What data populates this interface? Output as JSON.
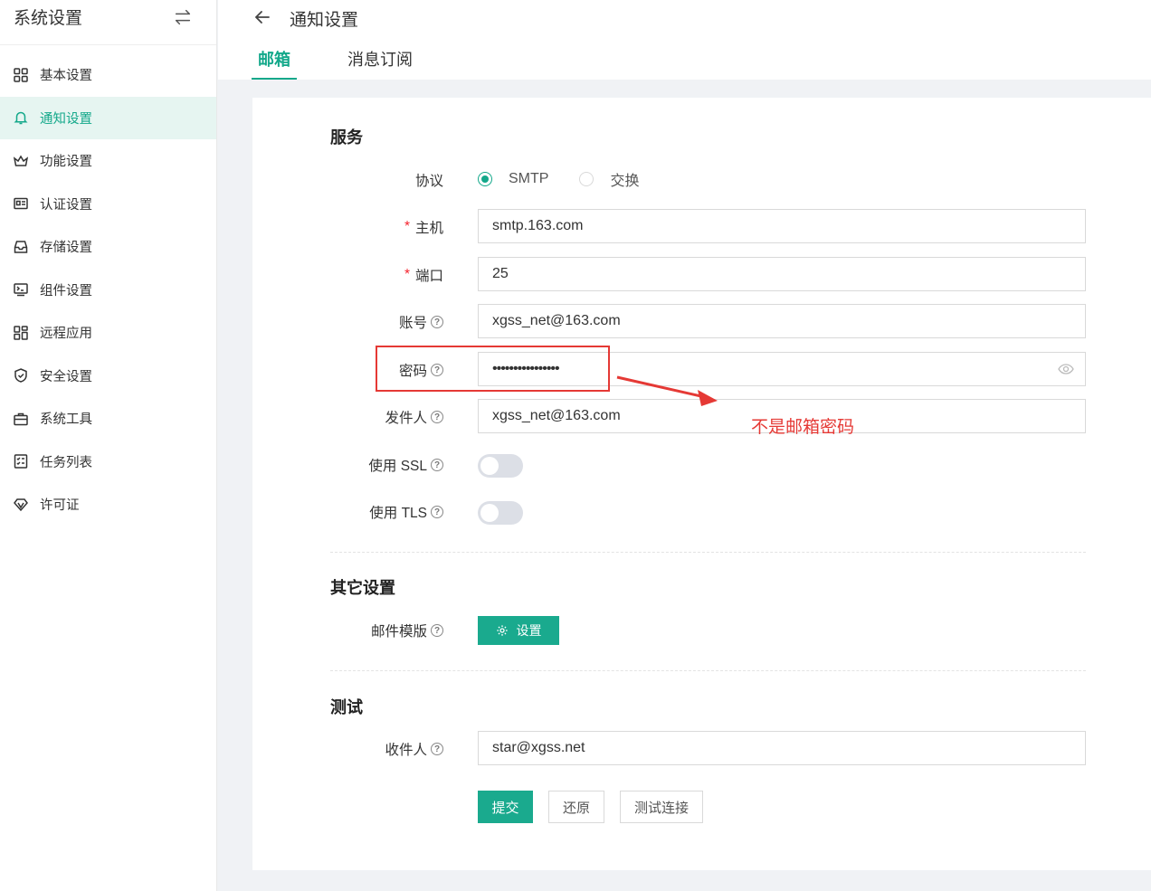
{
  "sidebar": {
    "title": "系统设置",
    "items": [
      {
        "label": "基本设置",
        "icon": "grid-icon"
      },
      {
        "label": "通知设置",
        "icon": "bell-icon",
        "active": true
      },
      {
        "label": "功能设置",
        "icon": "crown-icon"
      },
      {
        "label": "认证设置",
        "icon": "id-card-icon"
      },
      {
        "label": "存储设置",
        "icon": "inbox-icon"
      },
      {
        "label": "组件设置",
        "icon": "terminal-icon"
      },
      {
        "label": "远程应用",
        "icon": "apps-icon"
      },
      {
        "label": "安全设置",
        "icon": "shield-icon"
      },
      {
        "label": "系统工具",
        "icon": "toolbox-icon"
      },
      {
        "label": "任务列表",
        "icon": "task-list-icon"
      },
      {
        "label": "许可证",
        "icon": "diamond-icon"
      }
    ]
  },
  "header": {
    "title": "通知设置",
    "tabs": [
      {
        "label": "邮箱",
        "active": true
      },
      {
        "label": "消息订阅"
      }
    ]
  },
  "form": {
    "service_title": "服务",
    "protocol_label": "协议",
    "protocol_options": [
      "SMTP",
      "交换"
    ],
    "protocol_selected": "SMTP",
    "host_label": "主机",
    "host_value": "smtp.163.com",
    "port_label": "端口",
    "port_value": "25",
    "account_label": "账号",
    "account_value": "xgss_net@163.com",
    "password_label": "密码",
    "password_value": "••••••••••••••••",
    "sender_label": "发件人",
    "sender_value": "xgss_net@163.com",
    "ssl_label": "使用 SSL",
    "ssl_enabled": false,
    "tls_label": "使用 TLS",
    "tls_enabled": false,
    "other_title": "其它设置",
    "template_label": "邮件模版",
    "template_button": "设置",
    "test_title": "测试",
    "recipient_label": "收件人",
    "recipient_value": "star@xgss.net",
    "submit_button": "提交",
    "reset_button": "还原",
    "test_button": "测试连接",
    "help_mark": "?"
  },
  "annotation": {
    "text": "不是邮箱密码"
  },
  "colors": {
    "accent": "#13a88a",
    "annotation": "#e53935"
  }
}
